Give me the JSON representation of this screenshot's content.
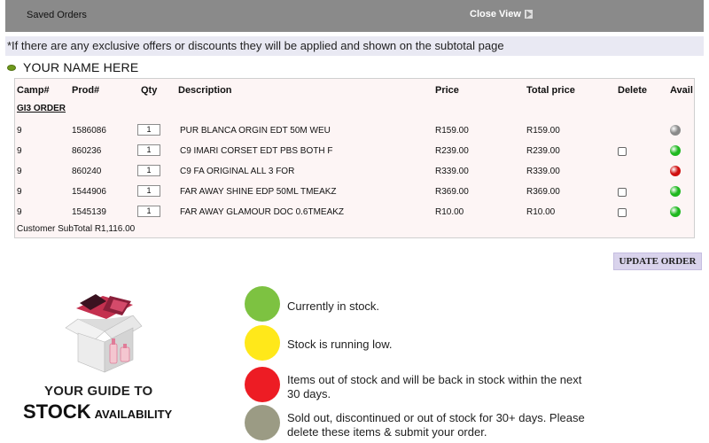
{
  "header": {
    "title": "Saved Orders",
    "close_label": "Close View"
  },
  "notice": "*If there are any exclusive offers or discounts they will be applied and shown on the subtotal page",
  "customer_name": "YOUR NAME HERE",
  "table": {
    "columns": {
      "camp": "Camp#",
      "prod": "Prod#",
      "qty": "Qty",
      "description": "Description",
      "price": "Price",
      "total": "Total price",
      "delete": "Delete",
      "avail": "Avail"
    },
    "group_label": "GI3 ORDER",
    "rows": [
      {
        "camp": "9",
        "prod": "1586086",
        "qty": "1",
        "description": "PUR BLANCA ORGIN EDT 50M WEU",
        "price": "R159.00",
        "total": "R159.00",
        "has_delete": false,
        "status": "gray"
      },
      {
        "camp": "9",
        "prod": "860236",
        "qty": "1",
        "description": "C9 IMARI CORSET EDT PBS BOTH F",
        "price": "R239.00",
        "total": "R239.00",
        "has_delete": true,
        "status": "green"
      },
      {
        "camp": "9",
        "prod": "860240",
        "qty": "1",
        "description": "C9 FA ORIGINAL ALL 3 FOR",
        "price": "R339.00",
        "total": "R339.00",
        "has_delete": false,
        "status": "red"
      },
      {
        "camp": "9",
        "prod": "1544906",
        "qty": "1",
        "description": "FAR AWAY SHINE EDP 50ML TMEAKZ",
        "price": "R369.00",
        "total": "R369.00",
        "has_delete": true,
        "status": "green"
      },
      {
        "camp": "9",
        "prod": "1545139",
        "qty": "1",
        "description": "FAR AWAY GLAMOUR DOC 0.6TMEAKZ",
        "price": "R10.00",
        "total": "R10.00",
        "has_delete": true,
        "status": "green"
      }
    ],
    "subtotal": "Customer SubTotal R1,116.00"
  },
  "update_button": "UPDATE ORDER",
  "guide": {
    "line1": "YOUR GUIDE TO",
    "line2_big": "STOCK",
    "line2_small": "AVAILABILITY"
  },
  "legend": [
    {
      "color": "#7dc241",
      "text": "Currently in stock."
    },
    {
      "color": "#ffe81a",
      "text": "Stock is running low."
    },
    {
      "color": "#ed1c24",
      "text": "Items out of stock and will be back in stock within the next 30 days."
    },
    {
      "color": "#9b9b84",
      "text": "Sold out, discontinued or out of stock for 30+ days. Please delete these items & submit your order."
    }
  ],
  "status_colors": {
    "gray": "#8a8a8a",
    "green": "#1fb81f",
    "red": "#d01010"
  }
}
